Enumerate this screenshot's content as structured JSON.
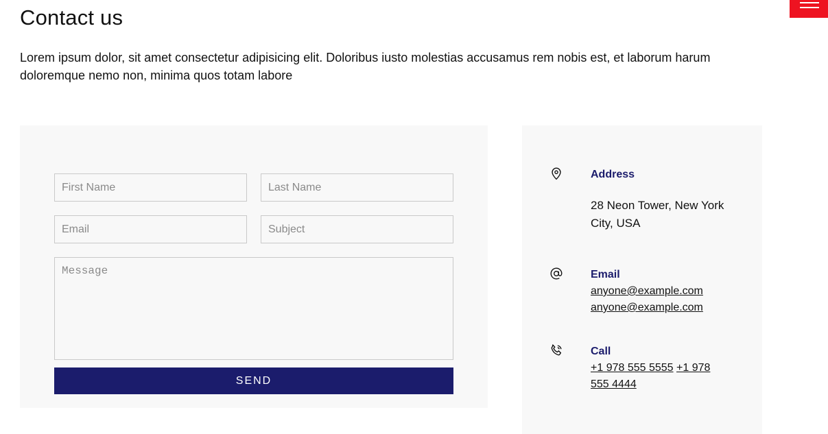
{
  "header": {
    "title": "Contact us",
    "intro": "Lorem ipsum dolor, sit amet consectetur adipisicing elit. Doloribus iusto molestias accusamus rem nobis est, et laborum harum doloremque nemo non, minima quos totam labore"
  },
  "colors": {
    "accent": "#1b1c6c",
    "menu": "#ee1321",
    "panel": "#f8f8f8"
  },
  "form": {
    "first_name_placeholder": "First Name",
    "last_name_placeholder": "Last Name",
    "email_placeholder": "Email",
    "subject_placeholder": "Subject",
    "message_placeholder": "Message",
    "send_label": "SEND"
  },
  "info": {
    "address": {
      "icon": "location-pin-icon",
      "label": "Address",
      "text": "28 Neon Tower, New York City, USA"
    },
    "email": {
      "icon": "at-sign-icon",
      "label": "Email",
      "links": [
        "anyone@example.com",
        "anyone@example.com"
      ]
    },
    "call": {
      "icon": "phone-icon",
      "label": "Call",
      "links": [
        "+1 978 555 5555",
        "+1 978 555 4444"
      ]
    }
  }
}
